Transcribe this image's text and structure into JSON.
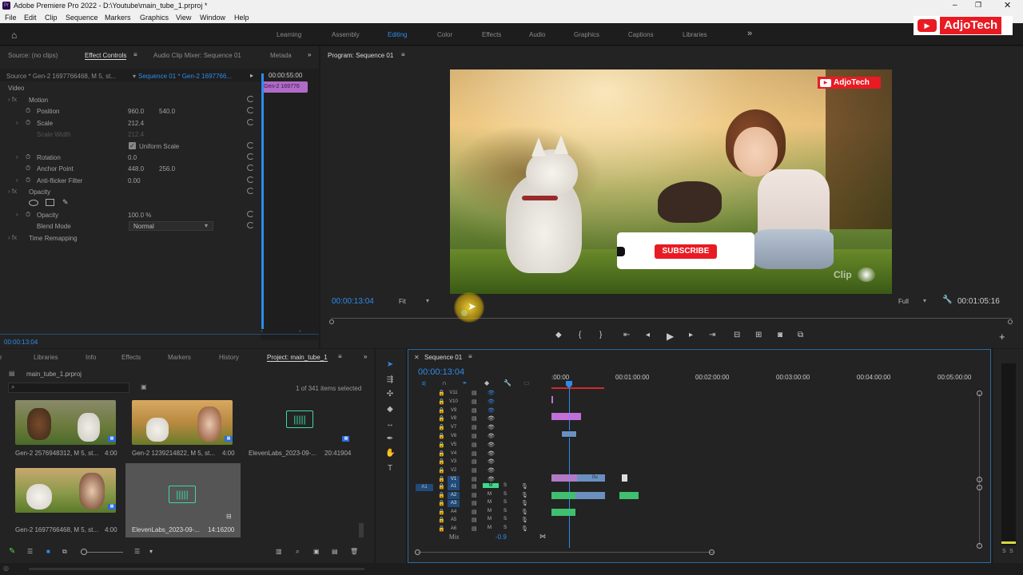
{
  "app": {
    "title": "Adobe Premiere Pro 2022 - D:\\Youtube\\main_tube_1.prproj *",
    "menus": [
      "File",
      "Edit",
      "Clip",
      "Sequence",
      "Markers",
      "Graphics",
      "View",
      "Window",
      "Help"
    ],
    "workspaces": [
      "Learning",
      "Assembly",
      "Editing",
      "Color",
      "Effects",
      "Audio",
      "Graphics",
      "Captions",
      "Libraries"
    ],
    "active_workspace": "Editing",
    "more_workspaces": "»"
  },
  "brand": {
    "name": "AdjoTech",
    "color": "#e81b23"
  },
  "source_panel": {
    "tabs": [
      "Source: (no clips)",
      "Effect Controls",
      "Audio Clip Mixer: Sequence 01",
      "Metada"
    ],
    "source_label": "Source * Gen-2 1697766468, M 5, st...",
    "sequence_label": "Sequence 01 * Gen-2 1697766...",
    "timecode": "00:00:55:00",
    "clip_label": "Gen-2 169776",
    "video_label": "Video",
    "motion": "Motion",
    "position_label": "Position",
    "position_x": "960.0",
    "position_y": "540.0",
    "scale_label": "Scale",
    "scale": "212.4",
    "scale_width_label": "Scale Width",
    "scale_width": "212.4",
    "uniform_scale": "Uniform Scale",
    "rotation_label": "Rotation",
    "rotation": "0.0",
    "anchor_label": "Anchor Point",
    "anchor_x": "448.0",
    "anchor_y": "256.0",
    "antiflicker_label": "Anti-flicker Filter",
    "antiflicker": "0.00",
    "opacity_section": "Opacity",
    "opacity_label": "Opacity",
    "opacity": "100.0 %",
    "blend_label": "Blend Mode",
    "blend": "Normal",
    "time_remap": "Time Remapping",
    "bottom_timecode": "00:00:13:04"
  },
  "program": {
    "tab": "Program: Sequence 01",
    "timecode": "00:00:13:04",
    "fit": "Fit",
    "quality": "Full",
    "duration": "00:01:05:16",
    "overlay_brand": "AdjoTech",
    "subscribe": "SUBSCRIBE",
    "watermark": "Clip"
  },
  "project": {
    "tabs": [
      "Libraries",
      "Info",
      "Effects",
      "Markers",
      "History",
      "Project: main_tube_1"
    ],
    "file": "main_tube_1.prproj",
    "selection": "1 of 341 items selected",
    "items": [
      {
        "name": "Gen-2 2576948312, M 5, st...",
        "duration": "4:00"
      },
      {
        "name": "Gen-2 1239214822, M 5, st...",
        "duration": "4:00"
      },
      {
        "name": "ElevenLabs_2023-09-...",
        "duration": "20:41904"
      },
      {
        "name": "Gen-2 1697766468, M 5, st...",
        "duration": "4:00"
      },
      {
        "name": "ElevenLabs_2023-09-...",
        "duration": "14:16200"
      }
    ]
  },
  "timeline": {
    "tab": "Sequence 01",
    "timecode": "00:00:13:04",
    "ruler": [
      ":00:00",
      "00:01:00:00",
      "00:02:00:00",
      "00:03:00:00",
      "00:04:00:00",
      "00:05:00:00"
    ],
    "video_tracks": [
      "V11",
      "V10",
      "V9",
      "V8",
      "V7",
      "V6",
      "V5",
      "V4",
      "V3",
      "V2",
      "V1"
    ],
    "audio_tracks": [
      "A1",
      "A2",
      "A3",
      "A4",
      "A5",
      "A6"
    ],
    "source_patch": "A1",
    "mix_label": "Mix",
    "mix_value": "-0.9",
    "v1_clip_label": "0u"
  },
  "meter": {
    "labels": [
      "S",
      "S"
    ]
  }
}
